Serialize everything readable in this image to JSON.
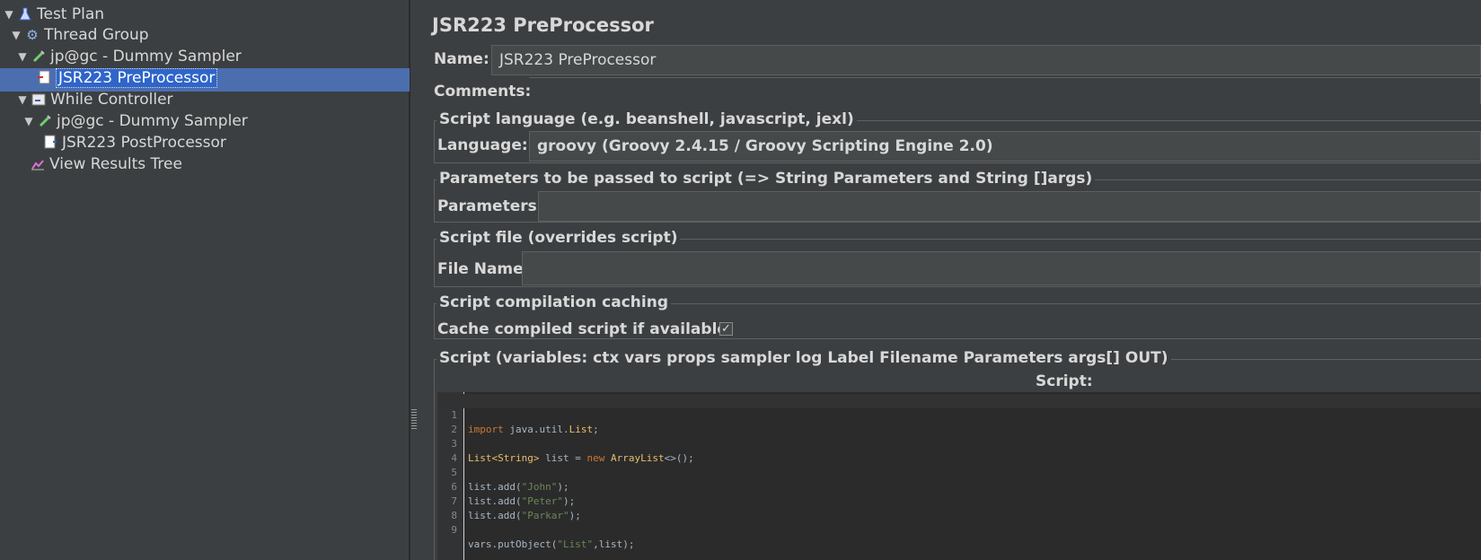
{
  "tree": {
    "items": [
      {
        "label": "Test Plan",
        "icon": "flask-icon"
      },
      {
        "label": "Thread Group",
        "icon": "gear-icon"
      },
      {
        "label": "jp@gc - Dummy Sampler",
        "icon": "pipette-icon"
      },
      {
        "label": "JSR223 PreProcessor",
        "icon": "preprocessor-icon"
      },
      {
        "label": "While Controller",
        "icon": "controller-icon"
      },
      {
        "label": "jp@gc - Dummy Sampler",
        "icon": "pipette-icon"
      },
      {
        "label": "JSR223 PostProcessor",
        "icon": "postprocessor-icon"
      },
      {
        "label": "View Results Tree",
        "icon": "chart-icon"
      }
    ],
    "selected_index": 3
  },
  "panel": {
    "title": "JSR223 PreProcessor",
    "name_label": "Name:",
    "name_value": "JSR223 PreProcessor",
    "comments_label": "Comments:",
    "script_language_group": "Script language (e.g. beanshell, javascript, jexl)",
    "language_label": "Language:",
    "language_value": "groovy     (Groovy 2.4.15 / Groovy Scripting Engine 2.0)",
    "parameters_group": "Parameters to be passed to script (=> String Parameters and String []args)",
    "parameters_label": "Parameters:",
    "parameters_value": "",
    "script_file_group": "Script file (overrides script)",
    "file_name_label": "File Name:",
    "file_name_value": "",
    "caching_group": "Script compilation caching",
    "cache_label": "Cache compiled script if available:",
    "cache_checked": true,
    "cache_check_glyph": "✓",
    "script_group": "Script (variables: ctx vars props sampler log Label Filename Parameters args[] OUT)",
    "script_label": "Script:"
  },
  "code": {
    "line_numbers": [
      "1",
      "2",
      "3",
      "4",
      "5",
      "6",
      "7",
      "8",
      "9"
    ],
    "lines": [
      {
        "kw": "import",
        "rest": " java.util.",
        "ty": "List",
        "tail": ";"
      },
      {
        "text": ""
      },
      {
        "ty1": "List",
        "ty2": "<String>",
        "mid": " list = ",
        "kw": "new",
        "ty3": " ArrayList",
        "tail": "<>();"
      },
      {
        "text": ""
      },
      {
        "pre": "list.add(",
        "str": "\"John\"",
        "post": ");"
      },
      {
        "pre": "list.add(",
        "str": "\"Peter\"",
        "post": ");"
      },
      {
        "pre": "list.add(",
        "str": "\"Parkar\"",
        "post": ");"
      },
      {
        "text": ""
      },
      {
        "pre": "vars.putObject(",
        "str": "\"List\"",
        "post": ",list);"
      }
    ]
  },
  "colors": {
    "background": "#3c3f41",
    "selection": "#4b6eaf",
    "editor_bg": "#2b2b2b",
    "keyword": "#cc7832",
    "type": "#e8bf6a",
    "string": "#6a8759"
  }
}
